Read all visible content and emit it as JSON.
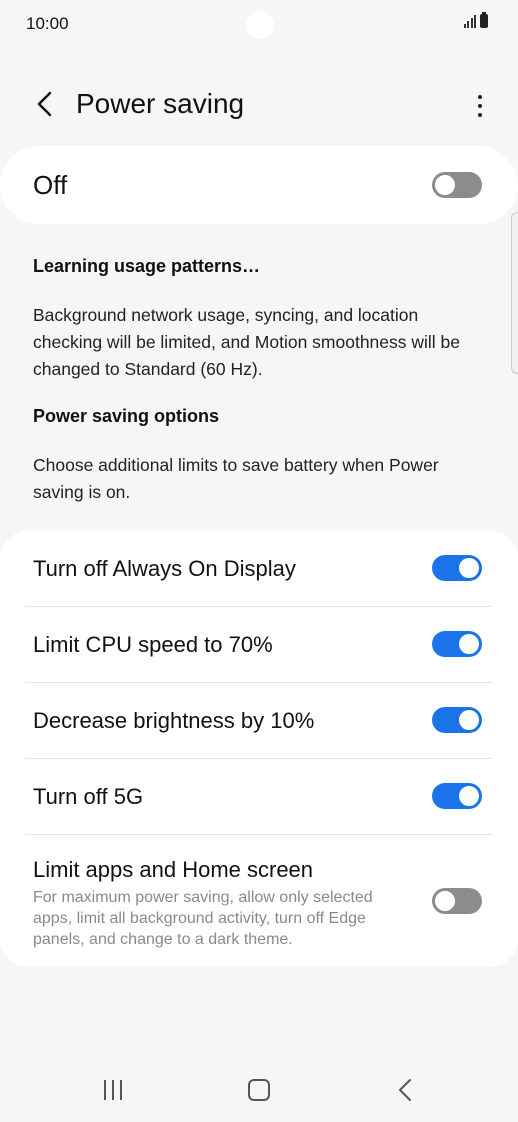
{
  "status_bar": {
    "time": "10:00"
  },
  "header": {
    "title": "Power saving"
  },
  "master": {
    "label": "Off",
    "on": false
  },
  "info": {
    "learning_title": "Learning usage patterns…",
    "learning_desc": "Background network usage, syncing, and location checking will be limited, and Motion smoothness will be changed to Standard (60 Hz).",
    "options_title": "Power saving options",
    "options_desc": "Choose additional limits to save battery when Power saving is on."
  },
  "options": [
    {
      "label": "Turn off Always On Display",
      "on": true
    },
    {
      "label": "Limit CPU speed to 70%",
      "on": true
    },
    {
      "label": "Decrease brightness by 10%",
      "on": true
    },
    {
      "label": "Turn off 5G",
      "on": true
    },
    {
      "label": "Limit apps and Home screen",
      "sub": "For maximum power saving, allow only selected apps, limit all background activity, turn off Edge panels, and change to a dark theme.",
      "on": false
    }
  ],
  "colors": {
    "toggle_on": "#1a73e8",
    "toggle_off": "#8c8c8c",
    "background": "#f6f6f6"
  }
}
